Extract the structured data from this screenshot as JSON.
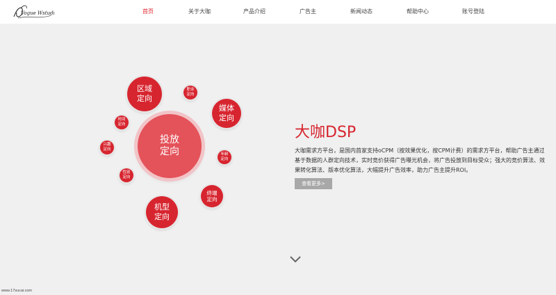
{
  "brand": {
    "logo_text": "Vogue Wstudio"
  },
  "nav": {
    "items": [
      {
        "label": "首页"
      },
      {
        "label": "关于大咖"
      },
      {
        "label": "产品介绍"
      },
      {
        "label": "广告主"
      },
      {
        "label": "新闻动态"
      },
      {
        "label": "帮助中心"
      },
      {
        "label": "账号登陆"
      }
    ]
  },
  "diagram": {
    "center": {
      "line1": "投放",
      "line2": "定向"
    },
    "region": {
      "line1": "区域",
      "line2": "定向"
    },
    "media": {
      "line1": "媒体",
      "line2": "定向"
    },
    "device": {
      "line1": "机型",
      "line2": "定向"
    },
    "career": {
      "line1": "职业",
      "line2": "定向"
    },
    "time": {
      "line1": "时间",
      "line2": "定向"
    },
    "interest": {
      "line1": "兴趣",
      "line2": "定向"
    },
    "gender": {
      "line1": "性别",
      "line2": "定向"
    },
    "age": {
      "line1": "年龄",
      "line2": "定向"
    },
    "terminal": {
      "line1": "终端",
      "line2": "定向"
    }
  },
  "hero": {
    "title": "大咖DSP",
    "description": "大咖需求方平台，是国内首家支持oCPM（按效果优化，按CPM计费）的需求方平台，帮助广告主通过基于数据的人群定向技术，实时竞价获得广告曝光机会，将广告投放到目标受众；强大的竞价算法、效果转化算法、版本优化算法，大幅提升广告效率，助力广告主提升ROI。",
    "more_button": "查看更多>"
  },
  "footer": {
    "url": "www.17sucai.com"
  },
  "colors": {
    "accent": "#d7252f",
    "center_bubble": "#e4525a",
    "background": "#f0f0f0"
  }
}
